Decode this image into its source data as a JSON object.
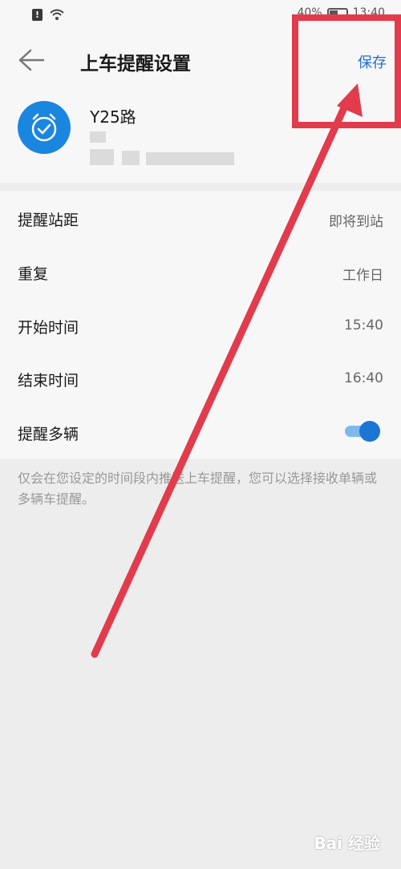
{
  "status_bar": {
    "battery_text": "40%",
    "time": "13:40"
  },
  "header": {
    "title": "上车提醒设置",
    "save_label": "保存"
  },
  "route": {
    "name": "Y25路"
  },
  "settings": [
    {
      "label": "提醒站距",
      "value": "即将到站"
    },
    {
      "label": "重复",
      "value": "工作日"
    },
    {
      "label": "开始时间",
      "value": "15:40"
    },
    {
      "label": "结束时间",
      "value": "16:40"
    },
    {
      "label": "提醒多辆",
      "toggle_on": true
    }
  ],
  "footnote": "仅会在您设定的时间段内推送上车提醒，您可以选择接收单辆或多辆车提醒。",
  "watermark": "Bai 经验",
  "colors": {
    "accent": "#1a76d2",
    "annotation_red": "#e23b4c"
  }
}
